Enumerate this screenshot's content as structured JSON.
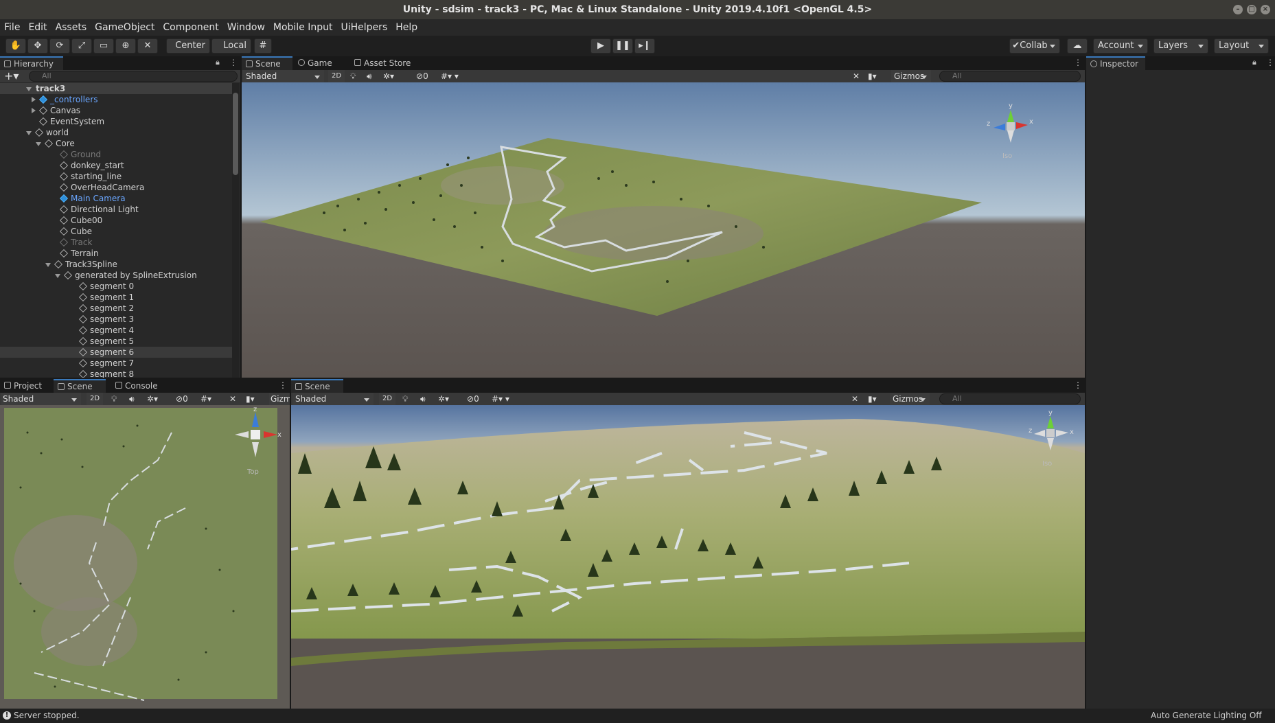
{
  "window": {
    "title": "Unity - sdsim - track3 - PC, Mac & Linux Standalone - Unity 2019.4.10f1 <OpenGL 4.5>"
  },
  "menu": [
    "File",
    "Edit",
    "Assets",
    "GameObject",
    "Component",
    "Window",
    "Mobile Input",
    "UiHelpers",
    "Help"
  ],
  "toolbar": {
    "pivot_label": "Center",
    "space_label": "Local",
    "collab_label": "Collab",
    "account_label": "Account",
    "layers_label": "Layers",
    "layout_label": "Layout"
  },
  "hierarchy": {
    "tab_label": "Hierarchy",
    "search_placeholder": "All",
    "scene_name": "track3",
    "items": [
      {
        "label": "_controllers",
        "style": "blue",
        "toggle": "right"
      },
      {
        "label": "Canvas",
        "style": "normal",
        "toggle": "right"
      },
      {
        "label": "EventSystem",
        "style": "normal",
        "toggle": ""
      },
      {
        "label": "world",
        "style": "normal",
        "toggle": "down"
      },
      {
        "label": "Core",
        "style": "normal",
        "toggle": "down"
      },
      {
        "label": "Ground",
        "style": "disabled",
        "toggle": ""
      },
      {
        "label": "donkey_start",
        "style": "normal",
        "toggle": ""
      },
      {
        "label": "starting_line",
        "style": "normal",
        "toggle": ""
      },
      {
        "label": "OverHeadCamera",
        "style": "normal",
        "toggle": ""
      },
      {
        "label": "Main Camera",
        "style": "blue",
        "toggle": ""
      },
      {
        "label": "Directional Light",
        "style": "normal",
        "toggle": ""
      },
      {
        "label": "Cube00",
        "style": "normal",
        "toggle": ""
      },
      {
        "label": "Cube",
        "style": "normal",
        "toggle": ""
      },
      {
        "label": "Track",
        "style": "disabled",
        "toggle": ""
      },
      {
        "label": "Terrain",
        "style": "normal",
        "toggle": ""
      },
      {
        "label": "Track3Spline",
        "style": "normal",
        "toggle": "down"
      },
      {
        "label": "generated by SplineExtrusion",
        "style": "normal",
        "toggle": "down"
      },
      {
        "label": "segment 0",
        "style": "normal",
        "toggle": ""
      },
      {
        "label": "segment 1",
        "style": "normal",
        "toggle": ""
      },
      {
        "label": "segment 2",
        "style": "normal",
        "toggle": ""
      },
      {
        "label": "segment 3",
        "style": "normal",
        "toggle": ""
      },
      {
        "label": "segment 4",
        "style": "normal",
        "toggle": ""
      },
      {
        "label": "segment 5",
        "style": "normal",
        "toggle": ""
      },
      {
        "label": "segment 6",
        "style": "normal",
        "toggle": ""
      },
      {
        "label": "segment 7",
        "style": "normal",
        "toggle": ""
      },
      {
        "label": "segment 8",
        "style": "normal",
        "toggle": ""
      }
    ]
  },
  "top_view": {
    "tabs": [
      "Scene",
      "Game",
      "Asset Store"
    ],
    "shading": "Shaded",
    "mode_2d": "2D",
    "fx_count": "0",
    "gizmos": "Gizmos",
    "search_placeholder": "All",
    "gizmo_axes": {
      "y": "y",
      "x": "x",
      "z": "z"
    },
    "projection": "Iso"
  },
  "inspector": {
    "tab_label": "Inspector"
  },
  "bottom_left": {
    "tabs": [
      "Project",
      "Scene",
      "Console"
    ],
    "shading": "Shaded",
    "mode_2d": "2D",
    "fx_count": "0",
    "gizmos": "Gizm",
    "gizmo_axes": {
      "z": "z",
      "x": "x"
    },
    "projection": "Top"
  },
  "bottom_right": {
    "tab": "Scene",
    "shading": "Shaded",
    "mode_2d": "2D",
    "fx_count": "0",
    "gizmos": "Gizmos",
    "search_placeholder": "All",
    "gizmo_axes": {
      "y": "y",
      "x": "x",
      "z": "z"
    },
    "projection": "Iso"
  },
  "status": {
    "message": "Server stopped.",
    "lighting": "Auto Generate Lighting Off"
  },
  "colors": {
    "accent": "#3a79bb",
    "selection_blue": "#6aa6ff"
  }
}
